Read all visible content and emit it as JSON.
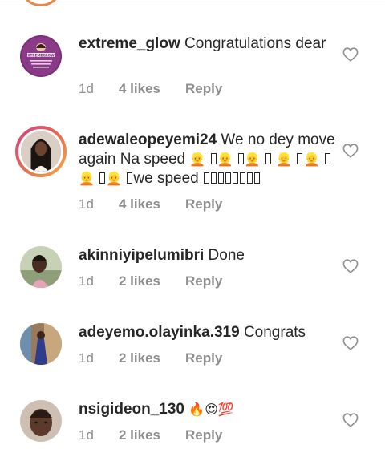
{
  "comments": [
    {
      "username": "extreme_glow",
      "text": " Congratulations dear",
      "time": "1d",
      "likes": "4 likes",
      "reply": "Reply",
      "avatar_text": "XTREMEGLOW"
    },
    {
      "username": "adewaleopeyemi24",
      "text": " We no dey move again Na speed ",
      "text2": "we speed",
      "time": "1d",
      "likes": "4 likes",
      "reply": "Reply"
    },
    {
      "username": "akinniyipelumibri",
      "text": " Done",
      "time": "1d",
      "likes": "2 likes",
      "reply": "Reply"
    },
    {
      "username": "adeyemo.olayinka.319",
      "text": " Congrats",
      "time": "1d",
      "likes": "2 likes",
      "reply": "Reply"
    },
    {
      "username": "nsigideon_130",
      "text": "",
      "emoji": "🔥😍💯",
      "time": "1d",
      "likes": "2 likes",
      "reply": "Reply"
    }
  ],
  "colors": {
    "text": "#262626",
    "meta": "#8e8e8e",
    "story_ring_start": "#d43c8c",
    "story_ring_end": "#f3b04a"
  },
  "icons": {
    "like": "heart-outline-icon",
    "fire": "fire-emoji",
    "love": "heart-eyes-emoji",
    "hundred": "hundred-points-emoji",
    "blonde": "blonde-person-emoji"
  }
}
